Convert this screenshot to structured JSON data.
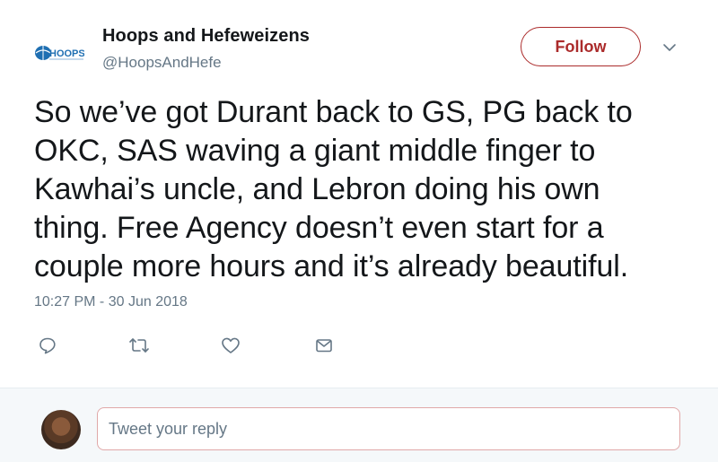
{
  "author": {
    "name": "Hoops and Hefeweizens",
    "handle": "@HoopsAndHefe",
    "logo_text": "HOOPS"
  },
  "follow_button": {
    "label": "Follow"
  },
  "tweet": {
    "text": "So we’ve got Durant back to GS, PG back to\nOKC, SAS waving a giant middle finger to\nKawhai’s uncle, and Lebron doing his own\nthing. Free Agency doesn’t even start for a\ncouple more hours and it’s already beautiful.",
    "timestamp": "10:27 PM - 30 Jun 2018"
  },
  "actions": [
    {
      "name": "reply",
      "icon": "reply-icon"
    },
    {
      "name": "retweet",
      "icon": "retweet-icon"
    },
    {
      "name": "like",
      "icon": "heart-icon"
    },
    {
      "name": "direct-message",
      "icon": "envelope-icon"
    }
  ],
  "reply": {
    "placeholder": "Tweet your reply"
  },
  "colors": {
    "accent": "#ab2b2b",
    "text": "#14171a",
    "secondary_text": "#657786",
    "logo_blue": "#1f6fb2"
  }
}
